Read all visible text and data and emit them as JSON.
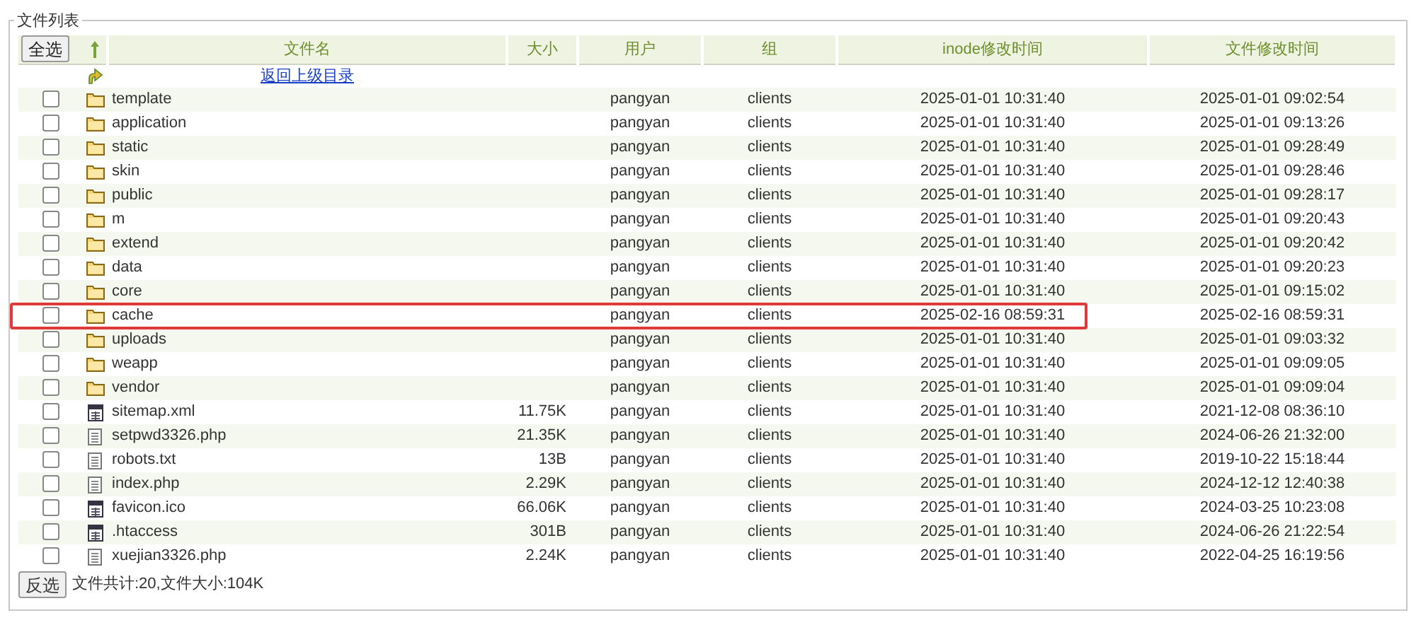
{
  "panel": {
    "legend": "文件列表"
  },
  "table": {
    "select_all_button": "全选",
    "columns": [
      "文件名",
      "大小",
      "用户",
      "组",
      "inode修改时间",
      "文件修改时间"
    ],
    "parent_link": "返回上级目录",
    "rows": [
      {
        "kind": "folder",
        "name": "template",
        "size": "",
        "user": "pangyan",
        "group": "clients",
        "inode_time": "2025-01-01 10:31:40",
        "mtime": "2025-01-01 09:02:54",
        "checked": false,
        "highlighted": false
      },
      {
        "kind": "folder",
        "name": "application",
        "size": "",
        "user": "pangyan",
        "group": "clients",
        "inode_time": "2025-01-01 10:31:40",
        "mtime": "2025-01-01 09:13:26",
        "checked": false,
        "highlighted": false
      },
      {
        "kind": "folder",
        "name": "static",
        "size": "",
        "user": "pangyan",
        "group": "clients",
        "inode_time": "2025-01-01 10:31:40",
        "mtime": "2025-01-01 09:28:49",
        "checked": false,
        "highlighted": false
      },
      {
        "kind": "folder",
        "name": "skin",
        "size": "",
        "user": "pangyan",
        "group": "clients",
        "inode_time": "2025-01-01 10:31:40",
        "mtime": "2025-01-01 09:28:46",
        "checked": false,
        "highlighted": false
      },
      {
        "kind": "folder",
        "name": "public",
        "size": "",
        "user": "pangyan",
        "group": "clients",
        "inode_time": "2025-01-01 10:31:40",
        "mtime": "2025-01-01 09:28:17",
        "checked": false,
        "highlighted": false
      },
      {
        "kind": "folder",
        "name": "m",
        "size": "",
        "user": "pangyan",
        "group": "clients",
        "inode_time": "2025-01-01 10:31:40",
        "mtime": "2025-01-01 09:20:43",
        "checked": false,
        "highlighted": false
      },
      {
        "kind": "folder",
        "name": "extend",
        "size": "",
        "user": "pangyan",
        "group": "clients",
        "inode_time": "2025-01-01 10:31:40",
        "mtime": "2025-01-01 09:20:42",
        "checked": false,
        "highlighted": false
      },
      {
        "kind": "folder",
        "name": "data",
        "size": "",
        "user": "pangyan",
        "group": "clients",
        "inode_time": "2025-01-01 10:31:40",
        "mtime": "2025-01-01 09:20:23",
        "checked": false,
        "highlighted": false
      },
      {
        "kind": "folder",
        "name": "core",
        "size": "",
        "user": "pangyan",
        "group": "clients",
        "inode_time": "2025-01-01 10:31:40",
        "mtime": "2025-01-01 09:15:02",
        "checked": false,
        "highlighted": false
      },
      {
        "kind": "folder",
        "name": "cache",
        "size": "",
        "user": "pangyan",
        "group": "clients",
        "inode_time": "2025-02-16 08:59:31",
        "mtime": "2025-02-16 08:59:31",
        "checked": false,
        "highlighted": true
      },
      {
        "kind": "folder",
        "name": "uploads",
        "size": "",
        "user": "pangyan",
        "group": "clients",
        "inode_time": "2025-01-01 10:31:40",
        "mtime": "2025-01-01 09:03:32",
        "checked": false,
        "highlighted": false
      },
      {
        "kind": "folder",
        "name": "weapp",
        "size": "",
        "user": "pangyan",
        "group": "clients",
        "inode_time": "2025-01-01 10:31:40",
        "mtime": "2025-01-01 09:09:05",
        "checked": false,
        "highlighted": false
      },
      {
        "kind": "folder",
        "name": "vendor",
        "size": "",
        "user": "pangyan",
        "group": "clients",
        "inode_time": "2025-01-01 10:31:40",
        "mtime": "2025-01-01 09:09:04",
        "checked": false,
        "highlighted": false
      },
      {
        "kind": "grid",
        "name": "sitemap.xml",
        "size": "11.75K",
        "user": "pangyan",
        "group": "clients",
        "inode_time": "2025-01-01 10:31:40",
        "mtime": "2021-12-08 08:36:10",
        "checked": false,
        "highlighted": false
      },
      {
        "kind": "text",
        "name": "setpwd3326.php",
        "size": "21.35K",
        "user": "pangyan",
        "group": "clients",
        "inode_time": "2025-01-01 10:31:40",
        "mtime": "2024-06-26 21:32:00",
        "checked": false,
        "highlighted": false
      },
      {
        "kind": "text",
        "name": "robots.txt",
        "size": "13B",
        "user": "pangyan",
        "group": "clients",
        "inode_time": "2025-01-01 10:31:40",
        "mtime": "2019-10-22 15:18:44",
        "checked": false,
        "highlighted": false
      },
      {
        "kind": "text",
        "name": "index.php",
        "size": "2.29K",
        "user": "pangyan",
        "group": "clients",
        "inode_time": "2025-01-01 10:31:40",
        "mtime": "2024-12-12 12:40:38",
        "checked": false,
        "highlighted": false
      },
      {
        "kind": "grid",
        "name": "favicon.ico",
        "size": "66.06K",
        "user": "pangyan",
        "group": "clients",
        "inode_time": "2025-01-01 10:31:40",
        "mtime": "2024-03-25 10:23:08",
        "checked": false,
        "highlighted": false
      },
      {
        "kind": "grid",
        "name": ".htaccess",
        "size": "301B",
        "user": "pangyan",
        "group": "clients",
        "inode_time": "2025-01-01 10:31:40",
        "mtime": "2024-06-26 21:22:54",
        "checked": false,
        "highlighted": false
      },
      {
        "kind": "text",
        "name": "xuejian3326.php",
        "size": "2.24K",
        "user": "pangyan",
        "group": "clients",
        "inode_time": "2025-01-01 10:31:40",
        "mtime": "2022-04-25 16:19:56",
        "checked": false,
        "highlighted": false
      }
    ]
  },
  "footer": {
    "invert_button": "反选",
    "summary": "文件共计:20,文件大小:104K"
  }
}
